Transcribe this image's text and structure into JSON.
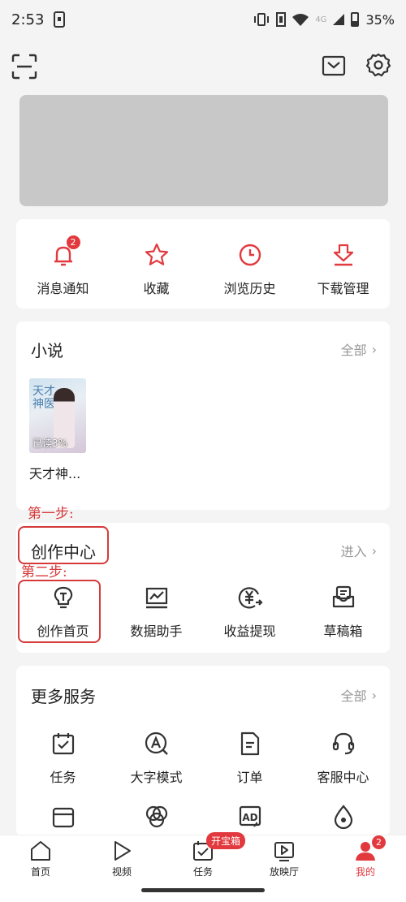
{
  "status_bar": {
    "time": "2:53",
    "network": "4G",
    "battery": "35%"
  },
  "top_bar": {
    "scan_icon": "scan-icon",
    "mail_icon": "mail-icon",
    "settings_icon": "gear-icon"
  },
  "quick_actions": [
    {
      "label": "消息通知",
      "icon": "bell-icon",
      "badge": "2"
    },
    {
      "label": "收藏",
      "icon": "star-icon"
    },
    {
      "label": "浏览历史",
      "icon": "clock-icon"
    },
    {
      "label": "下载管理",
      "icon": "download-icon"
    }
  ],
  "novel_section": {
    "title": "小说",
    "more": "全部",
    "book": {
      "title": "天才神...",
      "progress": "已读3%",
      "cover_text": "天才神医"
    }
  },
  "annotations": {
    "step1": "第一步:",
    "step2": "第二步:"
  },
  "create_section": {
    "title": "创作中心",
    "more": "进入",
    "items": [
      {
        "label": "创作首页",
        "icon": "lightbulb-icon"
      },
      {
        "label": "数据助手",
        "icon": "chart-icon"
      },
      {
        "label": "收益提现",
        "icon": "yuan-icon"
      },
      {
        "label": "草稿箱",
        "icon": "inbox-icon"
      }
    ]
  },
  "more_section": {
    "title": "更多服务",
    "more": "全部",
    "items": [
      {
        "label": "任务",
        "icon": "calendar-check-icon"
      },
      {
        "label": "大字模式",
        "icon": "font-icon"
      },
      {
        "label": "订单",
        "icon": "document-icon"
      },
      {
        "label": "客服中心",
        "icon": "headset-icon"
      }
    ],
    "row2_icons": [
      "card-icon",
      "circles-icon",
      "ad-icon",
      "drop-icon"
    ]
  },
  "tabbar": {
    "tabs": [
      {
        "label": "首页",
        "icon": "home-icon"
      },
      {
        "label": "视频",
        "icon": "play-icon"
      },
      {
        "label": "任务",
        "icon": "task-icon",
        "pill": "开宝箱"
      },
      {
        "label": "放映厅",
        "icon": "theater-icon"
      },
      {
        "label": "我的",
        "icon": "profile-icon",
        "badge": "2"
      }
    ]
  },
  "colors": {
    "accent": "#e2393e",
    "annotation": "#d63a3a"
  }
}
